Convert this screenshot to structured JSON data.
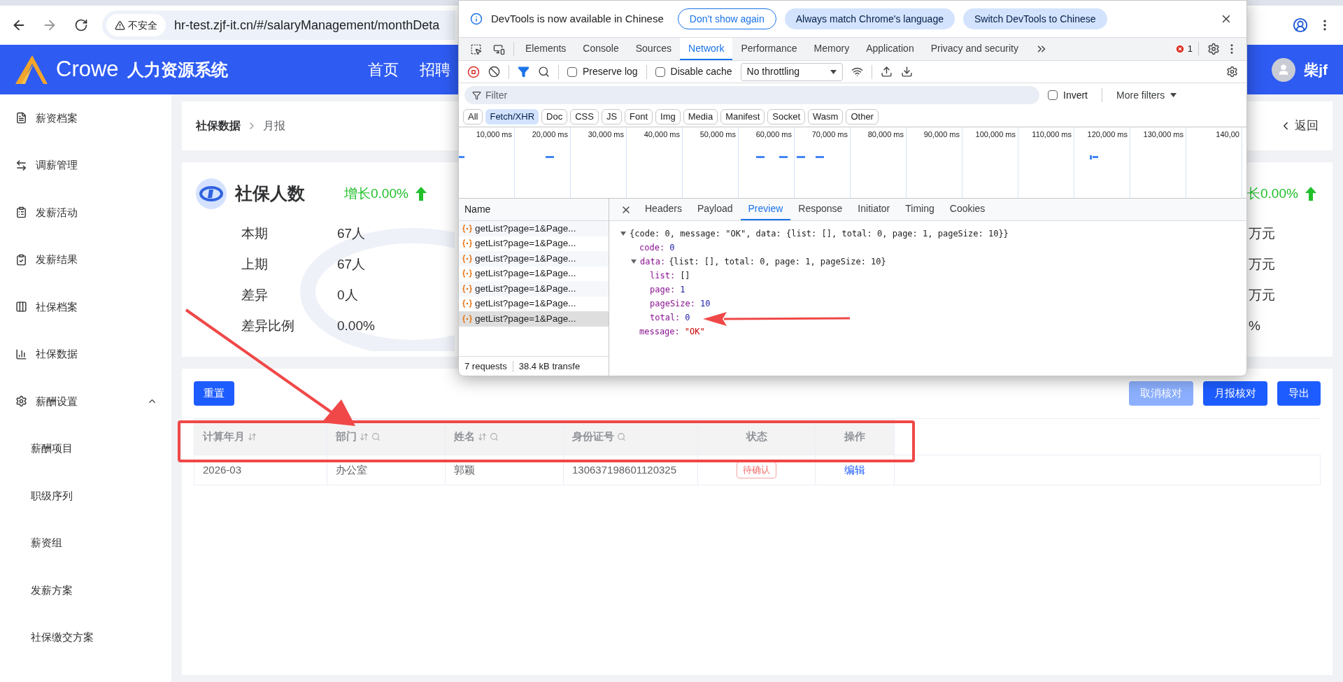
{
  "browser": {
    "security_label": "不安全",
    "url": "hr-test.zjf-it.cn/#/salaryManagement/monthDeta"
  },
  "header": {
    "brand": "Crowe",
    "system_name": "人力资源系统",
    "nav": [
      "首页",
      "招聘"
    ],
    "user": "柴jf"
  },
  "sidebar": {
    "items": [
      {
        "label": "薪资档案"
      },
      {
        "label": "调薪管理"
      },
      {
        "label": "发薪活动"
      },
      {
        "label": "发薪结果"
      },
      {
        "label": "社保档案"
      },
      {
        "label": "社保数据"
      },
      {
        "label": "薪酬设置",
        "expanded": true,
        "children": [
          {
            "label": "薪酬项目"
          },
          {
            "label": "职级序列"
          },
          {
            "label": "薪资组"
          },
          {
            "label": "发薪方案"
          },
          {
            "label": "社保缴交方案"
          }
        ]
      }
    ]
  },
  "breadcrumb": {
    "items": [
      "社保数据",
      "月报"
    ],
    "back": "返回"
  },
  "summary": {
    "title": "社保人数",
    "growth": "增长0.00%",
    "rows": [
      {
        "label": "本期",
        "value": "67人"
      },
      {
        "label": "上期",
        "value": "67人"
      },
      {
        "label": "差异",
        "value": "0人"
      },
      {
        "label": "差异比例",
        "value": "0.00%"
      }
    ],
    "right_growth": "长0.00%",
    "right_values": [
      "万元",
      "万元",
      "万元",
      "%"
    ]
  },
  "actions": {
    "reset": "重置",
    "buttons": [
      {
        "label": "取消核对",
        "disabled": true
      },
      {
        "label": "月报核对",
        "disabled": false
      },
      {
        "label": "导出",
        "disabled": false
      }
    ]
  },
  "table": {
    "columns": [
      {
        "label": "计算年月",
        "sortable": true,
        "searchable": false
      },
      {
        "label": "部门",
        "sortable": true,
        "searchable": true
      },
      {
        "label": "姓名",
        "sortable": true,
        "searchable": true
      },
      {
        "label": "身份证号",
        "sortable": false,
        "searchable": true
      },
      {
        "label": "状态",
        "sortable": false,
        "searchable": false
      },
      {
        "label": "操作",
        "sortable": false,
        "searchable": false
      }
    ],
    "rows": [
      {
        "cells": [
          "2026-03",
          "办公室",
          "郭颖",
          "130637198601120325"
        ],
        "status": "待确认",
        "action": "编辑"
      }
    ]
  },
  "devtools": {
    "banner": {
      "message": "DevTools is now available in Chinese",
      "buttons": [
        {
          "label": "Don't show again",
          "kind": "outline"
        },
        {
          "label": "Always match Chrome's language",
          "kind": "filled"
        },
        {
          "label": "Switch DevTools to Chinese",
          "kind": "filled"
        }
      ]
    },
    "tabs": [
      {
        "label": "Elements",
        "selected": false
      },
      {
        "label": "Console",
        "selected": false
      },
      {
        "label": "Sources",
        "selected": false
      },
      {
        "label": "Network",
        "selected": true
      },
      {
        "label": "Performance",
        "selected": false
      },
      {
        "label": "Memory",
        "selected": false
      },
      {
        "label": "Application",
        "selected": false
      },
      {
        "label": "Privacy and security",
        "selected": false
      }
    ],
    "error_count": "1",
    "preserve_log": {
      "label": "Preserve log",
      "checked": false
    },
    "disable_cache": {
      "label": "Disable cache",
      "checked": false
    },
    "throttling": "No throttling",
    "filter": {
      "placeholder": "Filter"
    },
    "invert": {
      "label": "Invert",
      "checked": false
    },
    "more_filters": "More filters",
    "type_filters": [
      {
        "label": "All",
        "selected": false
      },
      {
        "label": "Fetch/XHR",
        "selected": true
      },
      {
        "label": "Doc",
        "selected": false
      },
      {
        "label": "CSS",
        "selected": false
      },
      {
        "label": "JS",
        "selected": false
      },
      {
        "label": "Font",
        "selected": false
      },
      {
        "label": "Img",
        "selected": false
      },
      {
        "label": "Media",
        "selected": false
      },
      {
        "label": "Manifest",
        "selected": false
      },
      {
        "label": "Socket",
        "selected": false
      },
      {
        "label": "Wasm",
        "selected": false
      },
      {
        "label": "Other",
        "selected": false
      }
    ],
    "timeline_ticks": [
      "10,000 ms",
      "20,000 ms",
      "30,000 ms",
      "40,000 ms",
      "50,000 ms",
      "60,000 ms",
      "70,000 ms",
      "80,000 ms",
      "90,000 ms",
      "100,000 ms",
      "110,000 ms",
      "120,000 ms",
      "130,000 ms",
      "140,00"
    ],
    "name_header": "Name",
    "requests": [
      {
        "name": "getList?page=1&Page...",
        "selected": false
      },
      {
        "name": "getList?page=1&Page...",
        "selected": false
      },
      {
        "name": "getList?page=1&Page...",
        "selected": false
      },
      {
        "name": "getList?page=1&Page...",
        "selected": false
      },
      {
        "name": "getList?page=1&Page...",
        "selected": false
      },
      {
        "name": "getList?page=1&Page...",
        "selected": false
      },
      {
        "name": "getList?page=1&Page...",
        "selected": true
      }
    ],
    "footer": [
      "7 requests",
      "38.4 kB transfe"
    ],
    "detail_tabs": [
      {
        "label": "Headers",
        "selected": false
      },
      {
        "label": "Payload",
        "selected": false
      },
      {
        "label": "Preview",
        "selected": true
      },
      {
        "label": "Response",
        "selected": false
      },
      {
        "label": "Initiator",
        "selected": false
      },
      {
        "label": "Timing",
        "selected": false
      },
      {
        "label": "Cookies",
        "selected": false
      }
    ],
    "preview": {
      "summary": "{code: 0, message: \"OK\", data: {list: [], total: 0, page: 1, pageSize: 10}}",
      "expanded": true,
      "children": [
        {
          "key": "code:",
          "value": "0",
          "kind": "number"
        },
        {
          "key": "data:",
          "summary": "{list: [], total: 0, page: 1, pageSize: 10}",
          "expanded": true,
          "children": [
            {
              "key": "list:",
              "value": "[]",
              "kind": "plain"
            },
            {
              "key": "page:",
              "value": "1",
              "kind": "number"
            },
            {
              "key": "pageSize:",
              "value": "10",
              "kind": "number"
            },
            {
              "key": "total:",
              "value": "0",
              "kind": "number"
            }
          ]
        },
        {
          "key": "message:",
          "value": "\"OK\"",
          "kind": "string"
        }
      ]
    }
  }
}
